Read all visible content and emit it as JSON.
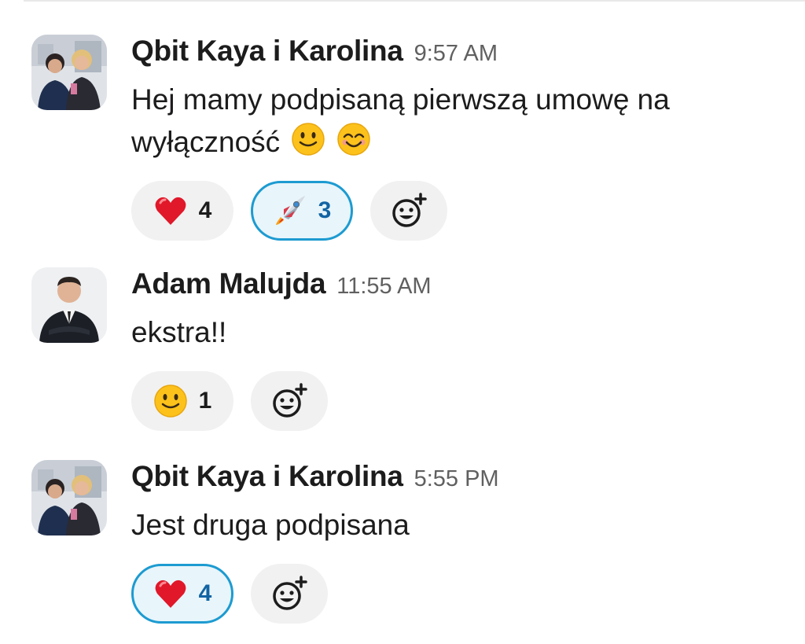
{
  "messages": [
    {
      "author": "Qbit Kaya i Karolina",
      "time": "9:57 AM",
      "text_line1": "Hej mamy podpisaną pierwszą umowę na",
      "text_line2": "wyłączność",
      "inline_emojis": [
        "slightly-smiling-face",
        "smiling-face-with-smiling-eyes"
      ],
      "reactions": [
        {
          "emoji": "red-heart",
          "count": "4",
          "active": false
        },
        {
          "emoji": "rocket",
          "count": "3",
          "active": true
        }
      ]
    },
    {
      "author": "Adam Malujda",
      "time": "11:55 AM",
      "text": "ekstra!!",
      "reactions": [
        {
          "emoji": "slightly-smiling-face",
          "count": "1",
          "active": false
        }
      ]
    },
    {
      "author": "Qbit Kaya i Karolina",
      "time": "5:55 PM",
      "text": "Jest druga podpisana",
      "reactions": [
        {
          "emoji": "red-heart",
          "count": "4",
          "active": true
        }
      ]
    }
  ],
  "colors": {
    "accent_border": "#1d9bd1",
    "accent_bg": "#e8f5fa",
    "pill_bg": "#f1f1f1",
    "timestamp": "#616061"
  }
}
